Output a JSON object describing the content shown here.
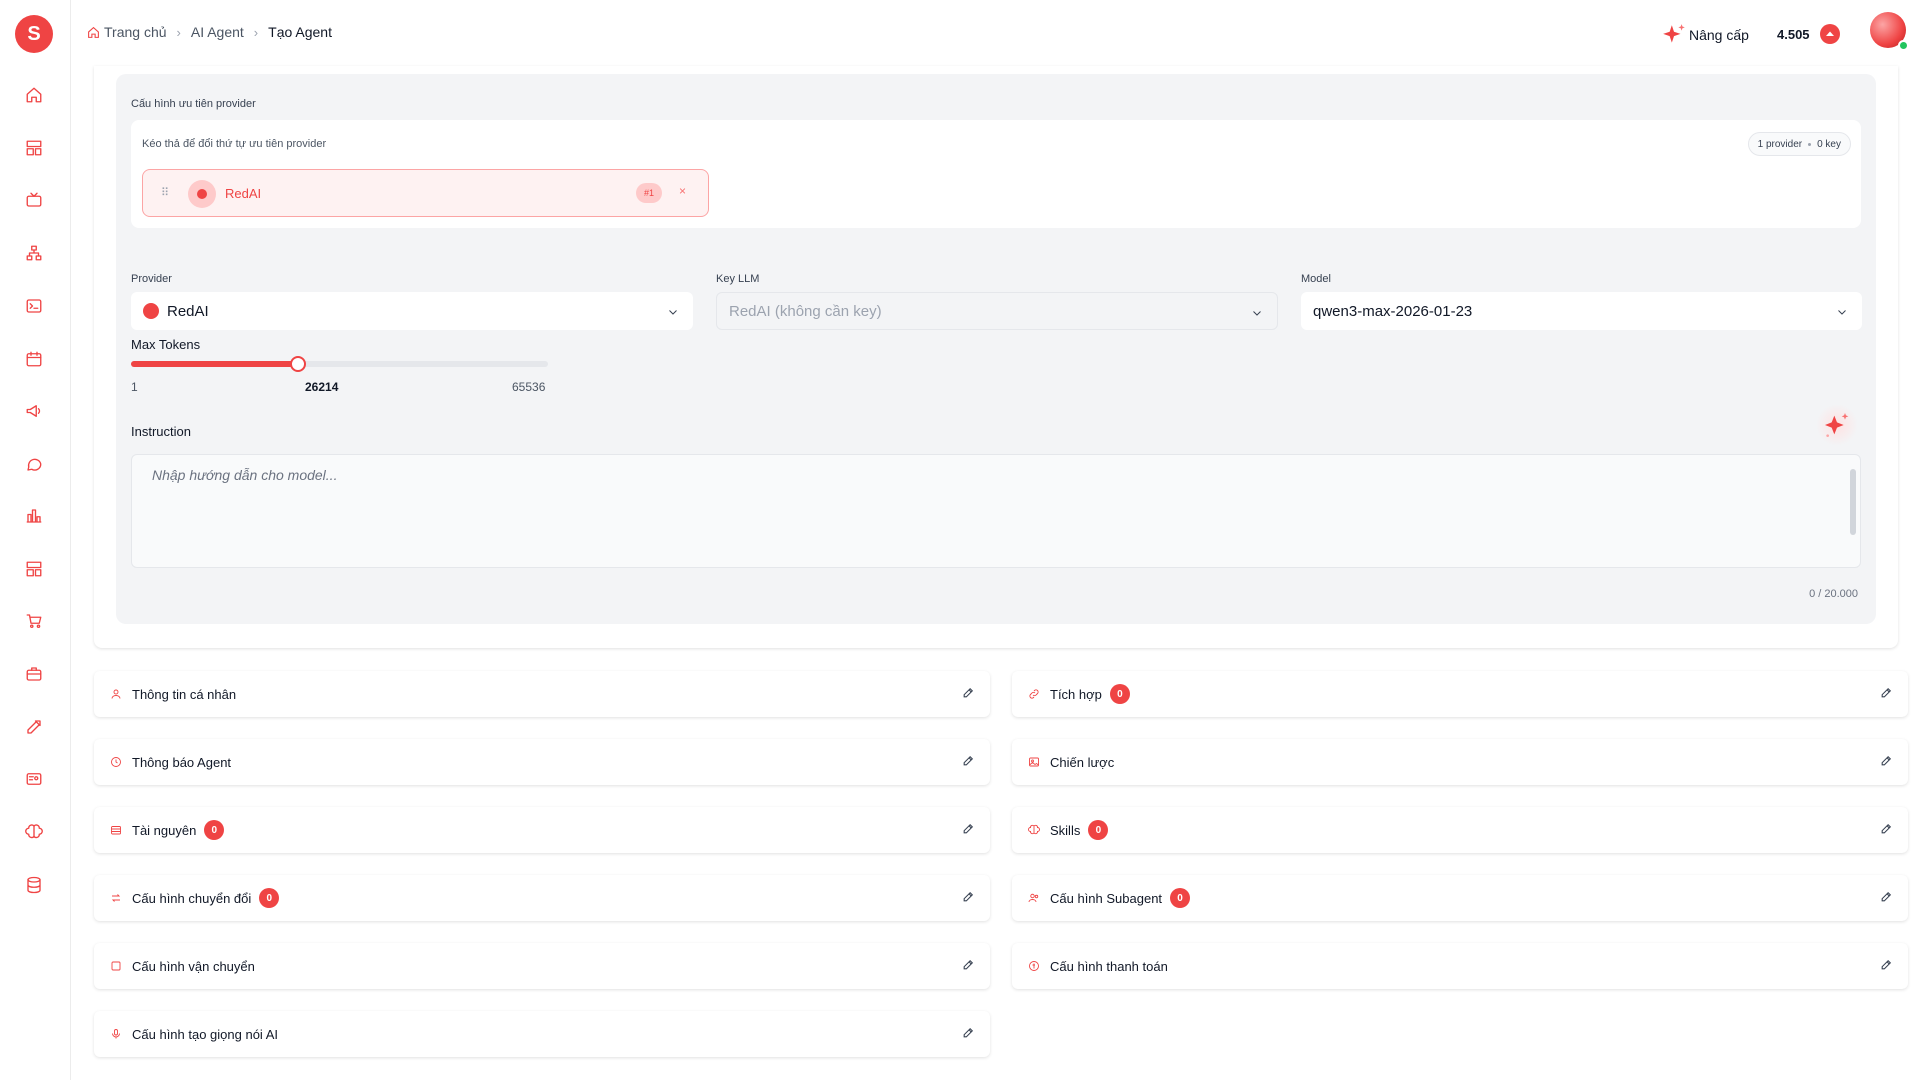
{
  "brand": {
    "accent": "#ef4444",
    "logo_letter": "S"
  },
  "sidebar": {
    "items": [
      {
        "name": "home-icon"
      },
      {
        "name": "layout-icon"
      },
      {
        "name": "tv-icon"
      },
      {
        "name": "sitemap-icon"
      },
      {
        "name": "terminal-icon"
      },
      {
        "name": "calendar-icon"
      },
      {
        "name": "megaphone-icon"
      },
      {
        "name": "chat-icon"
      },
      {
        "name": "chart-icon"
      },
      {
        "name": "grid-icon"
      },
      {
        "name": "cart-icon"
      },
      {
        "name": "briefcase-icon"
      },
      {
        "name": "edit-icon"
      },
      {
        "name": "id-card-icon"
      },
      {
        "name": "brain-icon"
      },
      {
        "name": "database-icon"
      }
    ]
  },
  "header": {
    "breadcrumb": [
      "Trang chủ",
      "AI Agent",
      "Tạo Agent"
    ],
    "upgrade_label": "Nâng cấp",
    "credits": "4.505"
  },
  "provider_config": {
    "section_label": "Cấu hình ưu tiên provider",
    "drag_hint": "Kéo thả để đổi thứ tự ưu tiên provider",
    "summary_providers": "1 provider",
    "summary_keys": "0 key",
    "items": [
      {
        "name": "RedAI",
        "rank": "#1",
        "remove": "×"
      }
    ]
  },
  "fields": {
    "provider_label": "Provider",
    "provider_value": "RedAI",
    "key_label": "Key LLM",
    "key_value": "RedAI (không cần key)",
    "model_label": "Model",
    "model_value": "qwen3-max-2026-01-23"
  },
  "max_tokens": {
    "label": "Max Tokens",
    "min": 1,
    "max": 65536,
    "value": 26214,
    "min_label": "1",
    "max_label": "65536",
    "value_label": "26214"
  },
  "instruction": {
    "label": "Instruction",
    "placeholder": "Nhập hướng dẫn cho model...",
    "counter": "0 / 20.000"
  },
  "sections": [
    {
      "title": "Thông tin cá nhân",
      "icon": "user-icon",
      "badge": null
    },
    {
      "title": "Tích hợp",
      "icon": "link-icon",
      "badge": "0"
    },
    {
      "title": "Thông báo Agent",
      "icon": "bell-icon",
      "badge": null
    },
    {
      "title": "Chiến lược",
      "icon": "image-icon",
      "badge": null
    },
    {
      "title": "Tài nguyên",
      "icon": "folder-icon",
      "badge": "0"
    },
    {
      "title": "Skills",
      "icon": "brain-icon",
      "badge": "0"
    },
    {
      "title": "Cấu hình chuyển đổi",
      "icon": "arrows-icon",
      "badge": "0"
    },
    {
      "title": "Cấu hình Subagent",
      "icon": "users-icon",
      "badge": "0"
    },
    {
      "title": "Cấu hình vận chuyển",
      "icon": "box-icon",
      "badge": null
    },
    {
      "title": "Cấu hình thanh toán",
      "icon": "wallet-icon",
      "badge": null
    },
    {
      "title": "Cấu hình tạo giọng nói AI",
      "icon": "mic-icon",
      "badge": null
    }
  ]
}
